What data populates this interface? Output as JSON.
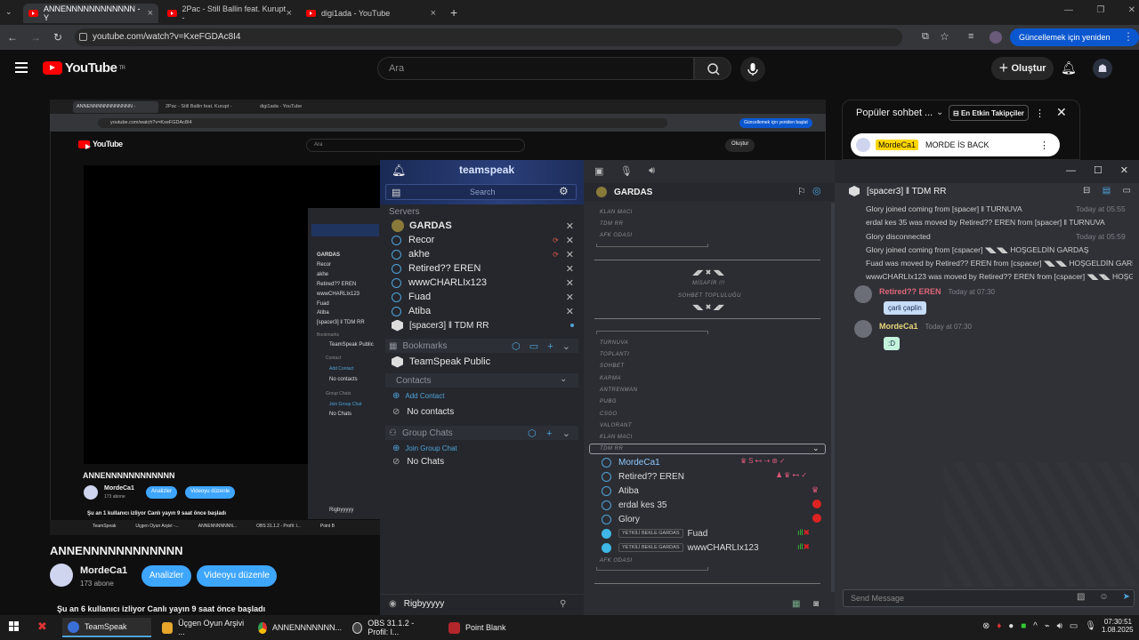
{
  "browser": {
    "tabs": [
      {
        "title": "ANNENNNNNNNNNNNN - Y",
        "active": true
      },
      {
        "title": "2Pac - Still Ballin feat. Kurupt -",
        "active": false
      },
      {
        "title": "digi1ada - YouTube",
        "active": false
      }
    ],
    "url": "youtube.com/watch?v=KxeFGDAc8I4",
    "update_label": "Güncellemek için yeniden başlat"
  },
  "youtube": {
    "logo": "YouTube",
    "logo_sup": "TR",
    "search_placeholder": "Ara",
    "create_label": "Oluştur",
    "video_title": "ANNENNNNNNNNNNNN",
    "channel_name": "MordeCa1",
    "subscribers": "173 abone",
    "analytics_label": "Analizler",
    "edit_label": "Videoyu düzenle",
    "live_status": "Şu an 6 kullanıcı izliyor  Canlı yayın 9 saat önce başladı"
  },
  "inner_screen": {
    "url": "youtube.com/watch?v=KxeFGDAc8I4",
    "tabs": [
      "ANNENNNNNNNNNNNN -",
      "2Pac - Still Ballin feat. Kurupt -",
      "digi1ada - YouTube"
    ],
    "update_label": "Güncellemek için yeniden başlat",
    "search": "Ara",
    "create": "Oluştur",
    "logo": "YouTube",
    "video_title": "ANNENNNNNNNNNNNN",
    "channel": "MordeCa1",
    "subs": "173 abone",
    "analytics": "Analizler",
    "edit": "Videoyu düzenle",
    "live_status": "Şu an 1 kullanıcı izliyor  Canlı yayın 9 saat önce başladı",
    "taskbar": [
      "TeamSpeak",
      "Üçgen Oyun Arşivi -...",
      "ANNENNNNNNN...",
      "OBS 31.1.2 - Profil: l...",
      "Point B"
    ],
    "ts_servers": [
      "GARDAS",
      "Recor",
      "akhe",
      "Retired?? EREN",
      "wwwCHARLIx123",
      "Fuad",
      "Atiba",
      "[spacer3] ‖ TDM RR"
    ],
    "ts_bookmarks": "Bookmarks",
    "ts_public": "TeamSpeak Public",
    "ts_contact": "Contact",
    "ts_add_contact": "Add Contact",
    "ts_no_contacts": "No contacts",
    "ts_group": "Group Chats",
    "ts_join": "Join Group Chat",
    "ts_no_chats": "No Chats",
    "ts_footer": "Rigbyyyyy"
  },
  "chat": {
    "title": "Popüler sohbet ...",
    "filter": "En Etkin Takipçiler",
    "pinned_user": "MordeCa1",
    "pinned_text": "MORDE İS BACK"
  },
  "teamspeak": {
    "brand": "teamspeak",
    "search_placeholder": "Search",
    "servers_label": "Servers",
    "servers": [
      {
        "name": "GARDAS",
        "bold": true
      },
      {
        "name": "Recor"
      },
      {
        "name": "akhe"
      },
      {
        "name": "Retired?? EREN"
      },
      {
        "name": "wwwCHARLIx123"
      },
      {
        "name": "Fuad"
      },
      {
        "name": "Atiba"
      },
      {
        "name": "[spacer3] ‖ TDM RR"
      }
    ],
    "bookmarks_label": "Bookmarks",
    "bookmark_item": "TeamSpeak Public",
    "contacts_label": "Contacts",
    "add_contact": "Add Contact",
    "no_contacts": "No contacts",
    "group_chats_label": "Group Chats",
    "join_group_chat": "Join Group Chat",
    "no_chats": "No Chats",
    "footer_user": "Rigbyyyyy",
    "server_title": "GARDAS",
    "top_channels": [
      "KLAN MACI",
      "TDM RR",
      "AFK ODASI"
    ],
    "banner_1": "MİSAFİR !!!",
    "banner_2": "SOHBET TOPLULUĞU",
    "channels": [
      "TURNUVA",
      "TOPLANTI",
      "SOHBET",
      "KARMA",
      "ANTRENMAN",
      "PUBG",
      "CSGO",
      "VALORANT",
      "KLAN MACI"
    ],
    "active_channel": "TDM RR",
    "users": [
      {
        "name": "MordeCa1",
        "highlight": true
      },
      {
        "name": "Retired?? EREN"
      },
      {
        "name": "Atiba"
      },
      {
        "name": "erdal kes 35"
      },
      {
        "name": "Glory"
      }
    ],
    "waiting_users": [
      {
        "tag": "YETKİLİ BEKLE GARDAS",
        "name": "Fuad"
      },
      {
        "tag": "YETKİLİ BEKLE GARDAS",
        "name": "wwwCHARLIx123"
      }
    ],
    "bottom_channel": "AFK ODASI",
    "chat_title": "[spacer3] ‖ TDM RR",
    "log": [
      {
        "text": "Glory joined coming from [spacer] ‖ TURNUVA",
        "time": "Today at 05:55"
      },
      {
        "text": "erdal kes 35 was moved by Retired?? EREN from [spacer] ‖ TURNUVA",
        "time": "Today at 05"
      },
      {
        "text": "Glory disconnected",
        "time": "Today at 05:59"
      },
      {
        "text": "Glory joined coming from [cspacer] ◥◣◥◣ HOŞGELDİN GARDAŞ",
        "time": "Today at"
      },
      {
        "text": "Fuad was moved by Retired?? EREN from [cspacer] ◥◣◥◣ HOŞGELDİN GARDAŞ",
        "time": ""
      },
      {
        "text": "wwwCHARLIx123 was moved by Retired?? EREN from [cspacer] ◥◣◥◣ HOŞGELDİN",
        "time": ""
      }
    ],
    "messages": [
      {
        "user": "Retired?? EREN",
        "time": "Today at 07:30",
        "text": "çarli çaplin",
        "color": "#e0667a"
      },
      {
        "user": "MordeCa1",
        "time": "Today at 07:30",
        "text": ":D",
        "color": "#e8d77a"
      }
    ],
    "send_placeholder": "Send Message"
  },
  "taskbar": {
    "items": [
      {
        "label": "TeamSpeak",
        "color": "#3b6fd8"
      },
      {
        "label": "Üçgen Oyun Arşivi ...",
        "color": "#e5a62b"
      },
      {
        "label": "ANNENNNNNNN...",
        "color": "#2f9e4f"
      },
      {
        "label": "OBS 31.1.2 - Profil: l...",
        "color": "#444"
      },
      {
        "label": "Point Blank",
        "color": "#b3262b"
      }
    ],
    "time": "07:30:51",
    "date": "1.08.2025"
  }
}
